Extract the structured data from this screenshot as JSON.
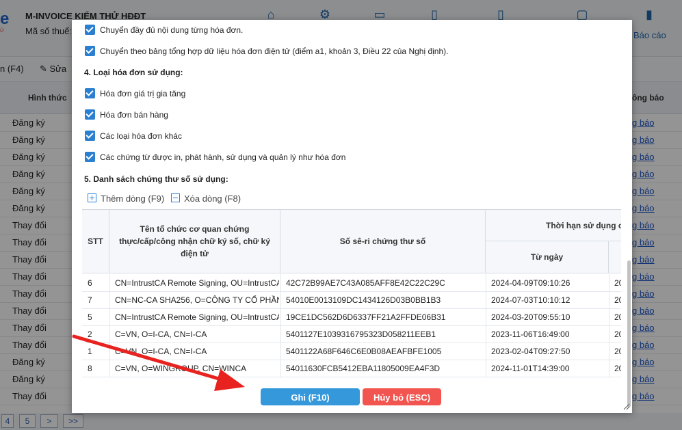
{
  "app": {
    "company": "M-INVOICE KIỂM THỬ HĐĐT",
    "tax_label": "Mã số thuế:",
    "logo_fragment": "e",
    "logo_sub": "Ử",
    "report_label": "Báo cáo",
    "nav_icons": [
      "home-icon",
      "gear-icon",
      "folder-icon",
      "document-icon",
      "document-edit-icon",
      "ticket-icon",
      "bar-chart-icon"
    ]
  },
  "toolbar": {
    "f4_label": "n (F4)",
    "edit_label": "Sửa"
  },
  "table": {
    "col_hinh_thuc": "Hình thức",
    "col_thong_bao": "ông báo",
    "rows": [
      {
        "hinh_thuc": "Đăng ký",
        "thong_bao": "g báo"
      },
      {
        "hinh_thuc": "Đăng ký",
        "thong_bao": "g báo"
      },
      {
        "hinh_thuc": "Đăng ký",
        "thong_bao": "g báo"
      },
      {
        "hinh_thuc": "Đăng ký",
        "thong_bao": "g báo"
      },
      {
        "hinh_thuc": "Đăng ký",
        "thong_bao": "g báo"
      },
      {
        "hinh_thuc": "Đăng ký",
        "thong_bao": "g báo"
      },
      {
        "hinh_thuc": "Thay đổi",
        "thong_bao": "g báo"
      },
      {
        "hinh_thuc": "Thay đổi",
        "thong_bao": "g báo"
      },
      {
        "hinh_thuc": "Thay đổi",
        "thong_bao": "g báo"
      },
      {
        "hinh_thuc": "Thay đổi",
        "thong_bao": "g báo"
      },
      {
        "hinh_thuc": "Thay đổi",
        "thong_bao": "g báo"
      },
      {
        "hinh_thuc": "Thay đổi",
        "thong_bao": "g báo"
      },
      {
        "hinh_thuc": "Thay đổi",
        "thong_bao": "g báo"
      },
      {
        "hinh_thuc": "Thay đổi",
        "thong_bao": "g báo"
      },
      {
        "hinh_thuc": "Đăng ký",
        "thong_bao": "g báo"
      },
      {
        "hinh_thuc": "Đăng ký",
        "thong_bao": "g báo"
      },
      {
        "hinh_thuc": "Thay đổi",
        "thong_bao": "g báo"
      }
    ]
  },
  "pager": {
    "pages": [
      "4",
      "5",
      ">",
      ">>"
    ]
  },
  "dialog": {
    "line1": "Chuyển đầy đủ nội dung từng hóa đơn.",
    "line2": "Chuyển theo bảng tổng hợp dữ liệu hóa đơn điện tử (điểm a1, khoản 3, Điều 22 của Nghị định).",
    "section4": "4. Loại hóa đơn sử dụng:",
    "invoice_types": [
      "Hóa đơn giá trị gia tăng",
      "Hóa đơn bán hàng",
      "Các loại hóa đơn khác",
      "Các chứng từ được in, phát hành, sử dụng và quản lý như hóa đơn"
    ],
    "section5": "5. Danh sách chứng thư số sử dụng:",
    "add_row": "Thêm dòng (F9)",
    "delete_row": "Xóa dòng (F8)",
    "grid": {
      "col_stt": "STT",
      "col_org": "Tên tổ chức cơ quan chứng thực/cấp/công nhận chữ ký số, chữ ký điện tử",
      "col_serial": "Số sê-ri chứng thư số",
      "col_validity": "Thời hạn sử dụng c",
      "col_from": "Từ ngày",
      "rows": [
        {
          "stt": "6",
          "org": "CN=IntrustCA Remote Signing, OU=IntrustCA",
          "serial": "42C72B99AE7C43A085AFF8E42C22C29C",
          "from": "2024-04-09T09:10:26",
          "to": "20"
        },
        {
          "stt": "7",
          "org": "CN=NC-CA SHA256, O=CÔNG TY CỔ PHẦN",
          "serial": "54010E0013109DC1434126D03B0BB1B3",
          "from": "2024-07-03T10:10:12",
          "to": "20"
        },
        {
          "stt": "5",
          "org": "CN=IntrustCA Remote Signing, OU=IntrustCA",
          "serial": "19CE1DC562D6D6337FF21A2FFDE06B31",
          "from": "2024-03-20T09:55:10",
          "to": "20"
        },
        {
          "stt": "2",
          "org": "C=VN, O=I-CA, CN=I-CA",
          "serial": "5401127E1039316795323D058211EEB1",
          "from": "2023-11-06T16:49:00",
          "to": "20"
        },
        {
          "stt": "1",
          "org": "C=VN, O=I-CA, CN=I-CA",
          "serial": "5401122A68F646C6E0B08AEAFBFE1005",
          "from": "2023-02-04T09:27:50",
          "to": "20"
        },
        {
          "stt": "8",
          "org": "C=VN, O=WINGROUP, CN=WINCA",
          "serial": "54011630FCB5412EBA11805009EA4F3D",
          "from": "2024-11-01T14:39:00",
          "to": "20"
        }
      ]
    },
    "save_button": "Ghi (F10)",
    "cancel_button": "Hủy bỏ (ESC)",
    "colors": {
      "save": "#3498db",
      "cancel": "#f2554f",
      "annotation_arrow": "#e8231f"
    }
  }
}
